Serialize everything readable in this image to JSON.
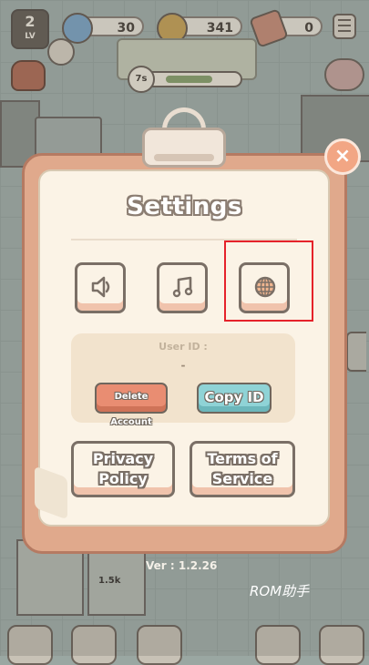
{
  "hud": {
    "level": "2",
    "level_suffix": "LV",
    "gems": "30",
    "coins": "341",
    "tickets": "0",
    "timer_label": "7s",
    "timer_progress": 0.65
  },
  "settings": {
    "title": "Settings",
    "sound_icon": "speaker-icon",
    "music_icon": "music-note-icon",
    "language_icon": "globe-icon",
    "user_id_label": "User ID :",
    "user_id_value": "-",
    "delete_account_label": "Delete Account",
    "copy_id_label": "Copy ID",
    "privacy_policy_label_line1": "Privacy",
    "privacy_policy_label_line2": "Policy",
    "terms_label_line1": "Terms of",
    "terms_label_line2": "Service",
    "close_label": "×",
    "version_label": "Ver : 1.2.26"
  },
  "background": {
    "price_label": "1.5k"
  },
  "watermark": "ROM助手",
  "colors": {
    "panel": "#e0a98c",
    "paper": "#fbf3e6",
    "delete_button": "#e98d72",
    "copy_button": "#8fd3d6",
    "highlight": "#e5222a"
  }
}
